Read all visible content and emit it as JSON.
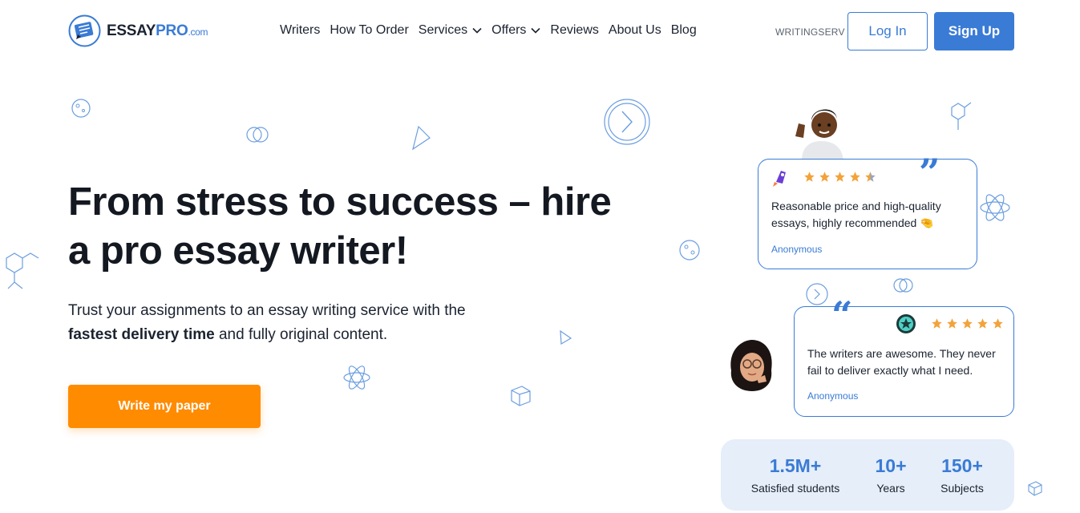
{
  "header": {
    "logo": {
      "brand_main": "ESSAY",
      "brand_accent": "PRO",
      "brand_domain": ".com"
    },
    "nav": [
      {
        "label": "Writers",
        "dropdown": false
      },
      {
        "label": "How To Order",
        "dropdown": false
      },
      {
        "label": "Services",
        "dropdown": true
      },
      {
        "label": "Offers",
        "dropdown": true
      },
      {
        "label": "Reviews",
        "dropdown": false
      },
      {
        "label": "About Us",
        "dropdown": false
      },
      {
        "label": "Blog",
        "dropdown": false
      }
    ],
    "promo_code": "WRITINGSERV",
    "login_label": "Log In",
    "signup_label": "Sign Up"
  },
  "hero": {
    "title_line1": "From stress to success – hire",
    "title_line2": "a pro essay writer!",
    "subtitle_part1": "Trust your assignments to an essay writing service with the",
    "subtitle_bold": "fastest delivery time",
    "subtitle_part2": " and fully original content.",
    "cta_label": "Write my paper"
  },
  "reviews": [
    {
      "text": "Reasonable price and high-quality essays, highly recommended 🤏",
      "author": "Anonymous",
      "rating": 4.5
    },
    {
      "text": "The writers are awesome. They never fail to deliver exactly what I need.",
      "author": "Anonymous",
      "rating": 5
    }
  ],
  "stats": [
    {
      "value": "1.5M+",
      "label": "Satisfied students"
    },
    {
      "value": "10+",
      "label": "Years"
    },
    {
      "value": "150+",
      "label": "Subjects"
    }
  ],
  "colors": {
    "accent": "#3a7bd5",
    "cta": "#ff8b00",
    "star": "#f2a33a",
    "stats_bg": "#e5eef9",
    "text": "#141820"
  },
  "icons": [
    "essaypro-logo-icon",
    "chevron-down-icon",
    "star-icon",
    "quote-icon",
    "rocket-icon",
    "star-badge-icon"
  ]
}
